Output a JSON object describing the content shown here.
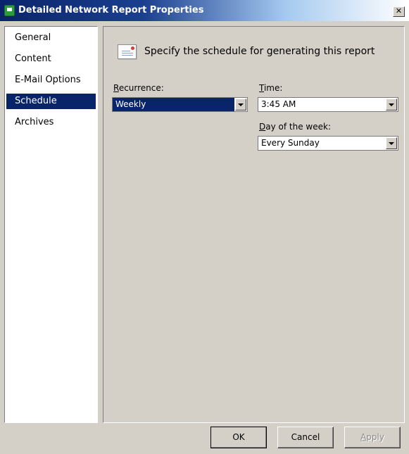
{
  "window": {
    "title": "Detailed Network Report Properties",
    "close_glyph": "✕"
  },
  "nav": {
    "items": [
      {
        "label": "General",
        "selected": false
      },
      {
        "label": "Content",
        "selected": false
      },
      {
        "label": "E-Mail Options",
        "selected": false
      },
      {
        "label": "Schedule",
        "selected": true
      },
      {
        "label": "Archives",
        "selected": false
      }
    ]
  },
  "schedule": {
    "heading": "Specify the schedule for generating this report",
    "recurrence": {
      "label_accel": "R",
      "label_rest": "ecurrence:",
      "value": "Weekly"
    },
    "time": {
      "label_accel": "T",
      "label_rest": "ime:",
      "value": "3:45 AM"
    },
    "day_of_week": {
      "label_accel": "D",
      "label_rest": "ay of the week:",
      "value": "Every Sunday"
    }
  },
  "buttons": {
    "ok": "OK",
    "cancel": "Cancel",
    "apply_accel": "A",
    "apply_rest": "pply"
  },
  "colors": {
    "selection": "#0a246a",
    "window_bg": "#d4d0c8"
  }
}
